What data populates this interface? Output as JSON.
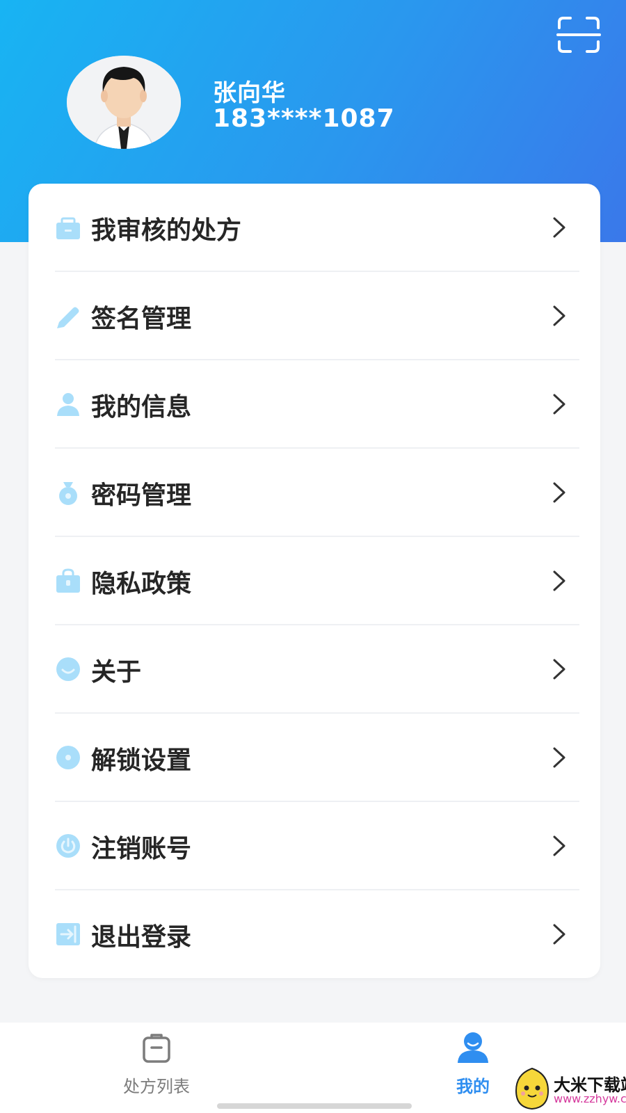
{
  "user": {
    "name": "张向华",
    "phone": "183****1087"
  },
  "menu": [
    {
      "label": "我审核的处方",
      "icon": "briefcase-icon"
    },
    {
      "label": "签名管理",
      "icon": "pencil-icon"
    },
    {
      "label": "我的信息",
      "icon": "person-icon"
    },
    {
      "label": "密码管理",
      "icon": "money-bag-icon"
    },
    {
      "label": "隐私政策",
      "icon": "bag-icon"
    },
    {
      "label": "关于",
      "icon": "smile-icon"
    },
    {
      "label": "解锁设置",
      "icon": "unlock-circle-icon"
    },
    {
      "label": "注销账号",
      "icon": "power-icon"
    },
    {
      "label": "退出登录",
      "icon": "exit-icon"
    }
  ],
  "tabbar": {
    "prescription_list": "处方列表",
    "mine": "我的"
  },
  "watermark": {
    "title": "大米下载站",
    "url": "www.zzhyw.com"
  },
  "colors": {
    "header_gradient_start": "#18b4f3",
    "header_gradient_end": "#3a78ea",
    "accent": "#2f8ef0",
    "icon_tint": "#a9defa"
  }
}
